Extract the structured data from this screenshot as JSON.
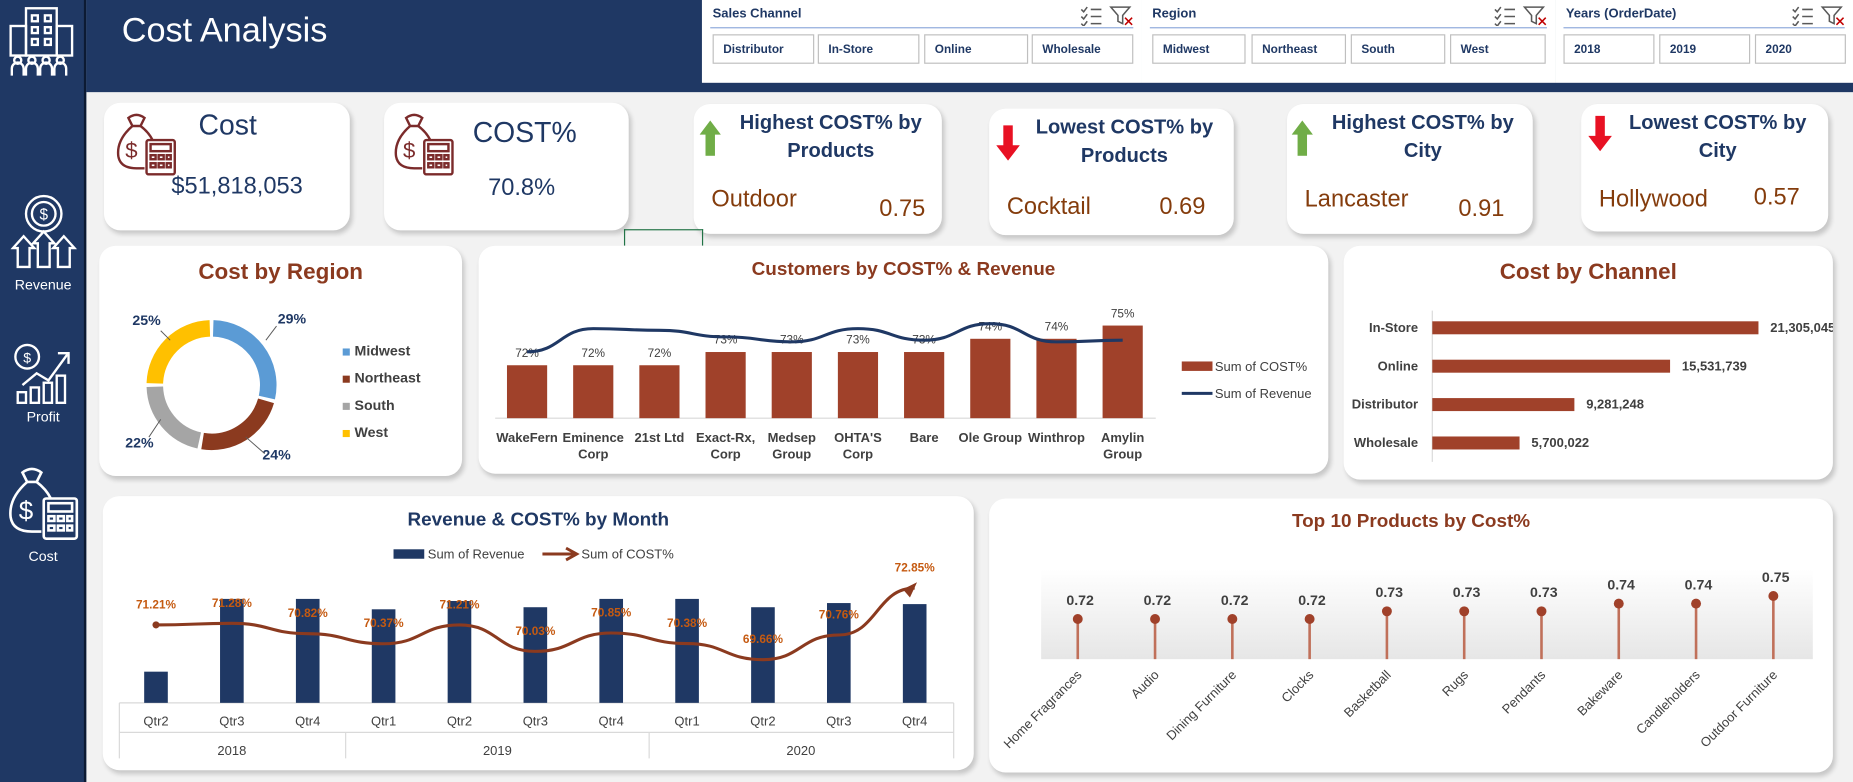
{
  "sidebar": {
    "items": [
      {
        "label": "Revenue",
        "icon": "revenue-icon"
      },
      {
        "label": "Profit",
        "icon": "profit-icon"
      },
      {
        "label": "Cost",
        "icon": "cost-icon"
      }
    ],
    "logo_icon": "building-people-icon"
  },
  "header": {
    "title": "Cost Analysis",
    "slicers": [
      {
        "label": "Sales Channel",
        "options": [
          "Distributor",
          "In-Store",
          "Online",
          "Wholesale"
        ]
      },
      {
        "label": "Region",
        "options": [
          "Midwest",
          "Northeast",
          "South",
          "West"
        ]
      },
      {
        "label": "Years (OrderDate)",
        "options": [
          "2018",
          "2019",
          "2020"
        ]
      }
    ]
  },
  "kpis": {
    "cost": {
      "label": "Cost",
      "value": "$51,818,053",
      "icon": "money-bag-calculator-icon"
    },
    "cost_pct": {
      "label": "COST%",
      "value": "70.8%",
      "icon": "money-bag-calculator-icon"
    }
  },
  "highlights": [
    {
      "title": "Highest COST% by Products",
      "name": "Outdoor",
      "value": "0.75",
      "direction": "up"
    },
    {
      "title": "Lowest COST% by Products",
      "name": "Cocktail",
      "value": "0.69",
      "direction": "down"
    },
    {
      "title": "Highest COST% by City",
      "name": "Lancaster",
      "value": "0.91",
      "direction": "up"
    },
    {
      "title": "Lowest COST% by City",
      "name": "Hollywood",
      "value": "0.57",
      "direction": "down"
    }
  ],
  "colors": {
    "navy": "#1f3864",
    "brown": "#8b3a1f",
    "bar_brown": "#a0412a",
    "blue": "#5b9bd5",
    "gray": "#a5a5a5",
    "gold": "#ffc000",
    "up_green": "#70ad47",
    "down_red": "#e81123",
    "highlight_text": "#843c0c",
    "month_label": "#c55a11"
  },
  "chart_data": [
    {
      "id": "cost-by-region",
      "type": "pie",
      "title": "Cost by Region",
      "categories": [
        "Midwest",
        "Northeast",
        "South",
        "West"
      ],
      "values": [
        29,
        24,
        22,
        25
      ],
      "labels": [
        "29%",
        "24%",
        "22%",
        "25%"
      ],
      "legend": "right"
    },
    {
      "id": "customers-cost-revenue",
      "type": "bar",
      "title": "Customers by COST% & Revenue",
      "categories": [
        "WakeFern",
        "Eminence Corp",
        "21st Ltd",
        "Exact-Rx, Corp",
        "Medsep Group",
        "OHTA'S Corp",
        "Bare",
        "Ole Group",
        "Winthrop",
        "Amylin Group"
      ],
      "series": [
        {
          "name": "Sum of COST%",
          "values": [
            72,
            72,
            72,
            73,
            73,
            73,
            73,
            74,
            74,
            75
          ],
          "labels": [
            "72%",
            "72%",
            "72%",
            "73%",
            "73%",
            "73%",
            "73%",
            "74%",
            "74%",
            "75%"
          ]
        },
        {
          "name": "Sum of Revenue",
          "type": "line",
          "values": [
            58,
            72,
            71,
            67,
            64,
            72,
            65,
            75,
            64,
            65
          ]
        }
      ],
      "legend": "right"
    },
    {
      "id": "cost-by-channel",
      "type": "bar",
      "orientation": "horizontal",
      "title": "Cost by Channel",
      "categories": [
        "In-Store",
        "Online",
        "Distributor",
        "Wholesale"
      ],
      "values": [
        21305045,
        15531739,
        9281248,
        5700022
      ],
      "labels": [
        "21,305,045",
        "15,531,739",
        "9,281,248",
        "5,700,022"
      ]
    },
    {
      "id": "revenue-cost-month",
      "type": "bar",
      "title": "Revenue & COST% by Month",
      "categories": [
        "Qtr2",
        "Qtr3",
        "Qtr4",
        "Qtr1",
        "Qtr2",
        "Qtr3",
        "Qtr4",
        "Qtr1",
        "Qtr2",
        "Qtr3",
        "Qtr4"
      ],
      "groups": [
        {
          "label": "2018",
          "count": 3
        },
        {
          "label": "2019",
          "count": 4
        },
        {
          "label": "2020",
          "count": 4
        }
      ],
      "series": [
        {
          "name": "Sum of Revenue",
          "values": [
            30,
            100,
            100,
            90,
            98,
            92,
            100,
            100,
            92,
            96,
            95
          ]
        },
        {
          "name": "Sum of COST%",
          "type": "line",
          "values": [
            71.21,
            71.28,
            70.82,
            70.37,
            71.21,
            70.03,
            70.85,
            70.38,
            69.66,
            70.76,
            72.85
          ],
          "labels": [
            "71.21%",
            "71.28%",
            "70.82%",
            "70.37%",
            "71.21%",
            "70.03%",
            "70.85%",
            "70.38%",
            "69.66%",
            "70.76%",
            "72.85%"
          ]
        }
      ],
      "legend": "top"
    },
    {
      "id": "top10-products",
      "type": "scatter",
      "style": "lollipop",
      "title": "Top 10 Products by Cost%",
      "categories": [
        "Home Fragrances",
        "Audio",
        "Dining Furniture",
        "Clocks",
        "Basketball",
        "Rugs",
        "Pendants",
        "Bakeware",
        "Candleholders",
        "Outdoor Furniture"
      ],
      "values": [
        0.72,
        0.72,
        0.72,
        0.72,
        0.73,
        0.73,
        0.73,
        0.74,
        0.74,
        0.75
      ],
      "labels": [
        "0.72",
        "0.72",
        "0.72",
        "0.72",
        "0.73",
        "0.73",
        "0.73",
        "0.74",
        "0.74",
        "0.75"
      ]
    }
  ]
}
